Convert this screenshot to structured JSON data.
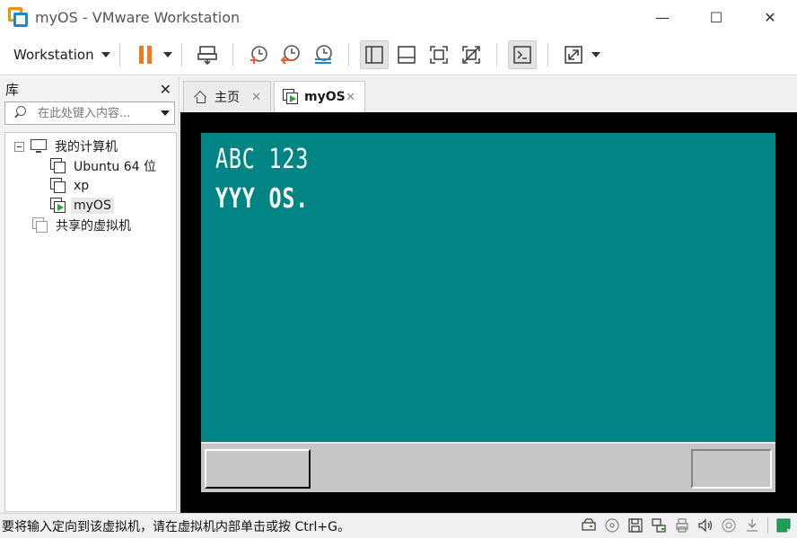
{
  "window": {
    "title": "myOS - VMware Workstation",
    "minimize_symbol": "—",
    "maximize_symbol": "☐",
    "close_symbol": "✕"
  },
  "toolbar": {
    "workstation_menu_label": "Workstation",
    "icons": [
      "pause-icon",
      "send-ctrl-alt-del-icon",
      "snapshot-take-icon",
      "snapshot-revert-icon",
      "snapshot-manager-icon",
      "show-library-icon",
      "thumbnail-bar-icon",
      "full-screen-icon",
      "unity-icon",
      "console-view-icon",
      "stretch-guest-icon"
    ],
    "colors": {
      "pause": "#f07a1e",
      "snapshot_accent": "#e85d2c",
      "snapshot_manager_accent": "#1e88c9"
    }
  },
  "library": {
    "title": "库",
    "close_symbol": "✕",
    "search_placeholder": "在此处键入内容...",
    "tree": {
      "root_label": "我的计算机",
      "vms": [
        {
          "label": "Ubuntu 64 位",
          "running": false
        },
        {
          "label": "xp",
          "running": false
        },
        {
          "label": "myOS",
          "running": true
        }
      ],
      "shared_label": "共享的虚拟机"
    }
  },
  "tabs": [
    {
      "label": "主页",
      "active": false,
      "close_symbol": "✕"
    },
    {
      "label": "myOS",
      "active": true,
      "close_symbol": "✕"
    }
  ],
  "vm_screen": {
    "background_color": "#008484",
    "lines": [
      "ABC 123",
      "YYY OS."
    ],
    "taskbar_color": "#c6c6c6"
  },
  "statusbar": {
    "message": "要将输入定向到该虚拟机，请在虚拟机内部单击或按 Ctrl+G。",
    "icons": [
      "hard-disk-icon",
      "cd-dvd-icon",
      "floppy-icon",
      "network-adapter-icon",
      "printer-icon",
      "sound-icon",
      "usb-icon",
      "message-log-icon"
    ]
  }
}
